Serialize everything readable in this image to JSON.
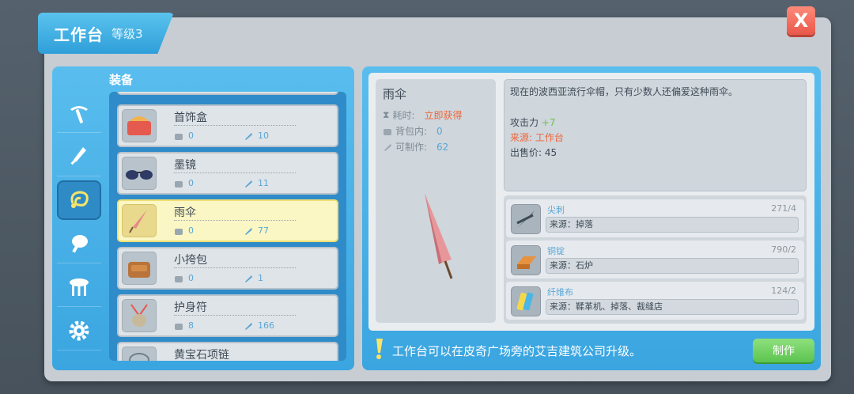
{
  "header": {
    "title": "工作台",
    "level": "等级3",
    "close_label": "X"
  },
  "category": {
    "label": "装备"
  },
  "side_tabs": [
    {
      "icon": "pickaxe-icon"
    },
    {
      "icon": "sword-icon"
    },
    {
      "icon": "accessory-icon",
      "active": true
    },
    {
      "icon": "food-icon"
    },
    {
      "icon": "furniture-icon"
    },
    {
      "icon": "gear-icon"
    }
  ],
  "items": [
    {
      "name": "首饰盒",
      "bag": "0",
      "craftable": "10",
      "icon": "jewelry-box-icon"
    },
    {
      "name": "墨镜",
      "bag": "0",
      "craftable": "11",
      "icon": "sunglasses-icon"
    },
    {
      "name": "雨伞",
      "bag": "0",
      "craftable": "77",
      "icon": "umbrella-icon",
      "selected": true
    },
    {
      "name": "小挎包",
      "bag": "0",
      "craftable": "1",
      "icon": "satchel-icon"
    },
    {
      "name": "护身符",
      "bag": "8",
      "craftable": "166",
      "icon": "amulet-icon"
    },
    {
      "name": "黄宝石项链",
      "bag": "",
      "craftable": "",
      "icon": "necklace-icon"
    }
  ],
  "detail": {
    "name": "雨伞",
    "time_label": "耗时:",
    "time_value": "立即获得",
    "bag_label": "背包内:",
    "bag_value": "0",
    "craft_label": "可制作:",
    "craft_value": "62",
    "description": "现在的波西亚流行伞帽，只有少数人还偏爱这种雨伞。",
    "attack_label": "攻击力",
    "attack_value": "+7",
    "source_label": "来源:",
    "source_value": "工作台",
    "price_label": "出售价:",
    "price_value": "45"
  },
  "materials": [
    {
      "name": "尖刺",
      "count": "271/4",
      "source": "来源：掉落",
      "icon": "spike-icon"
    },
    {
      "name": "铜锭",
      "count": "790/2",
      "source": "来源：石炉",
      "icon": "copper-ingot-icon"
    },
    {
      "name": "纤维布",
      "count": "124/2",
      "source": "来源：鞣革机、掉落、裁缝店",
      "icon": "fiber-cloth-icon"
    }
  ],
  "footer": {
    "tip": "工作台可以在皮奇广场旁的艾吉建筑公司升级。",
    "make_label": "制作"
  },
  "colors": {
    "panel_blue": "#3aa5e0",
    "highlight_orange": "#f0663a",
    "attack_green": "#6cc04a",
    "make_green": "#5cc44f",
    "close_red": "#e9584a"
  }
}
